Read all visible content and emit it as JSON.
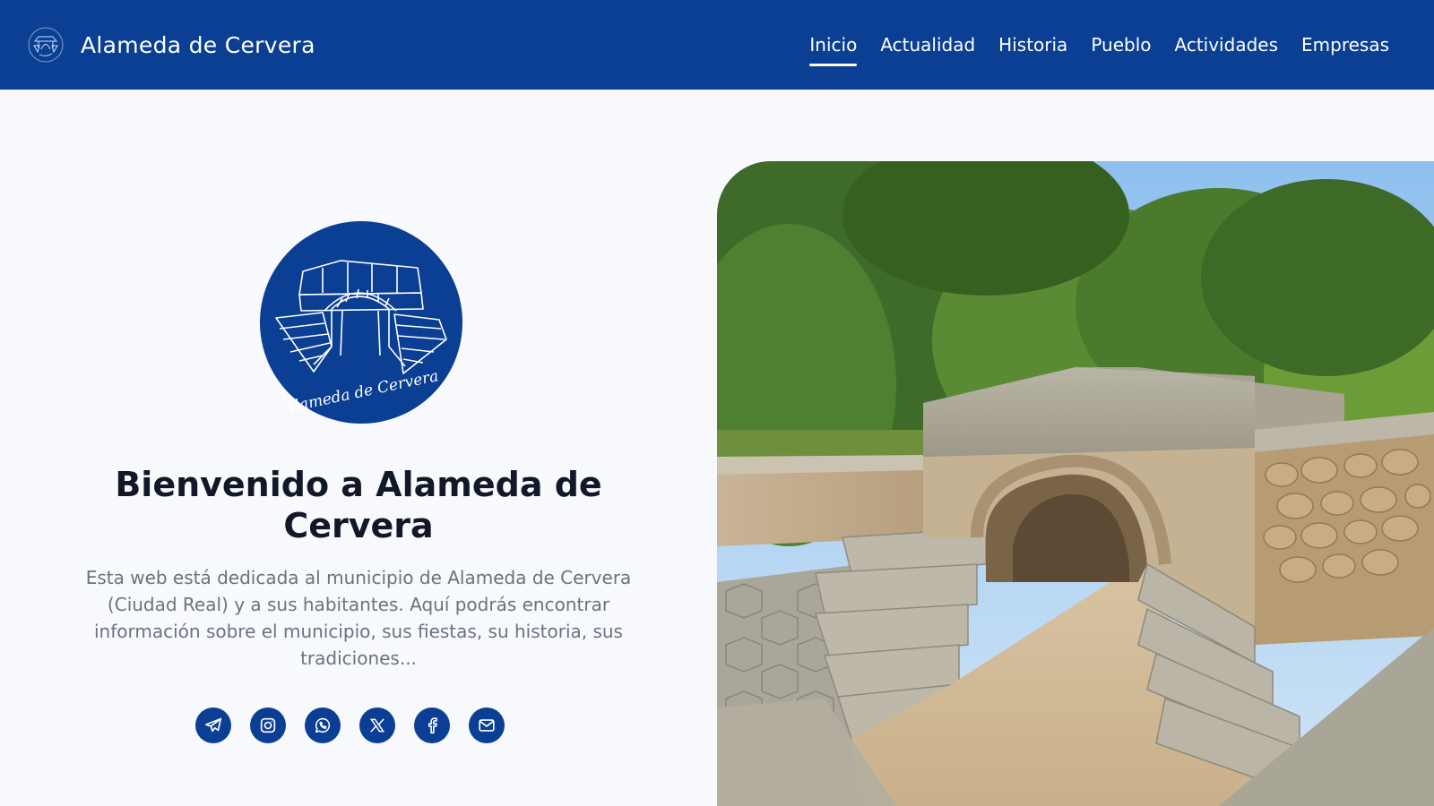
{
  "header": {
    "site_title": "Alameda de Cervera",
    "logo_icon": "bridge-emblem-icon",
    "nav": [
      {
        "label": "Inicio",
        "active": true
      },
      {
        "label": "Actualidad",
        "active": false
      },
      {
        "label": "Historia",
        "active": false
      },
      {
        "label": "Pueblo",
        "active": false
      },
      {
        "label": "Actividades",
        "active": false
      },
      {
        "label": "Empresas",
        "active": false
      }
    ]
  },
  "hero": {
    "logo_script": "Alameda de Cervera",
    "welcome_title": "Bienvenido a Alameda de Cervera",
    "intro_text": "Esta web está dedicada al municipio de Alameda de Cervera (Ciudad Real) y a sus habitantes. Aquí podrás encontrar información sobre el municipio, sus fiestas, su historia, sus tradiciones...",
    "image_subject": "stone-bridge-photo"
  },
  "social": [
    {
      "name": "telegram-icon"
    },
    {
      "name": "instagram-icon"
    },
    {
      "name": "whatsapp-icon"
    },
    {
      "name": "x-icon"
    },
    {
      "name": "facebook-icon"
    },
    {
      "name": "email-icon"
    }
  ],
  "colors": {
    "primary": "#0a3f94",
    "background": "#f7f9fc",
    "title": "#111827",
    "body_text": "#6b7280"
  }
}
